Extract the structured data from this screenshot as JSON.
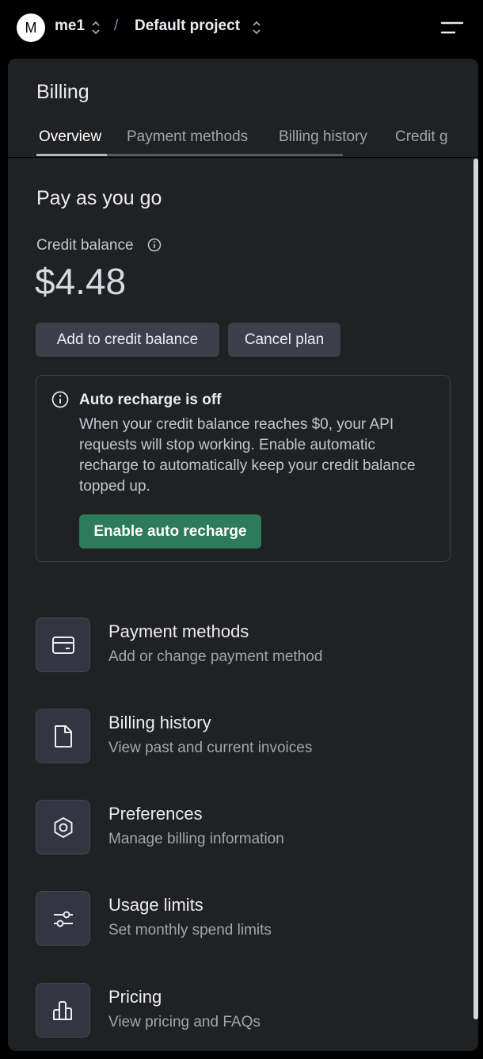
{
  "topbar": {
    "avatar_letter": "M",
    "org_name": "me1",
    "separator": "/",
    "project_name": "Default project"
  },
  "panel": {
    "title": "Billing",
    "tabs": [
      {
        "label": "Overview",
        "active": true
      },
      {
        "label": "Payment methods",
        "active": false
      },
      {
        "label": "Billing history",
        "active": false
      },
      {
        "label": "Credit g",
        "active": false
      }
    ],
    "plan_name": "Pay as you go",
    "credit_label": "Credit balance",
    "balance": "$4.48",
    "add_button": "Add to credit balance",
    "cancel_button": "Cancel plan",
    "alert": {
      "title": "Auto recharge is off",
      "body": "When your credit balance reaches $0, your API requests will stop working. Enable automatic recharge to automatically keep your credit balance topped up.",
      "button": "Enable auto recharge"
    },
    "links": [
      {
        "icon": "credit-card-icon",
        "title": "Payment methods",
        "desc": "Add or change payment method"
      },
      {
        "icon": "document-icon",
        "title": "Billing history",
        "desc": "View past and current invoices"
      },
      {
        "icon": "gear-icon",
        "title": "Preferences",
        "desc": "Manage billing information"
      },
      {
        "icon": "sliders-icon",
        "title": "Usage limits",
        "desc": "Set monthly spend limits"
      },
      {
        "icon": "bar-chart-icon",
        "title": "Pricing",
        "desc": "View pricing and FAQs"
      }
    ]
  },
  "colors": {
    "background": "#000000",
    "panel": "#202123",
    "button": "#3e3f4b",
    "accent_green": "#2d7a5c"
  }
}
